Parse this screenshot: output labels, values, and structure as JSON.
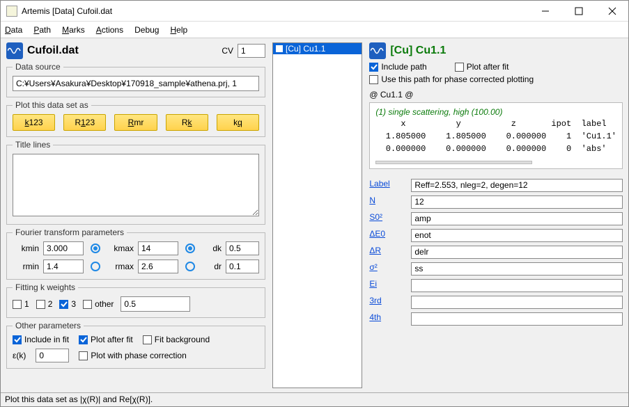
{
  "window": {
    "title": "Artemis [Data] Cufoil.dat"
  },
  "menu": {
    "data": "Data",
    "path": "Path",
    "marks": "Marks",
    "actions": "Actions",
    "debug": "Debug",
    "help": "Help"
  },
  "left": {
    "filename": "Cufoil.dat",
    "cv_label": "CV",
    "cv_value": "1",
    "source_legend": "Data source",
    "source_value": "C:¥Users¥Asakura¥Desktop¥170918_sample¥athena.prj, 1",
    "plot_legend": "Plot this data set as",
    "plot_buttons": {
      "k123": "k123",
      "r123": "R123",
      "rmr": "Rmr",
      "rk": "Rk",
      "kq": "kq"
    },
    "title_legend": "Title lines",
    "ft_legend": "Fourier transform parameters",
    "ft": {
      "kmin_l": "kmin",
      "kmin": "3.000",
      "kmax_l": "kmax",
      "kmax": "14",
      "dk_l": "dk",
      "dk": "0.5",
      "rmin_l": "rmin",
      "rmin": "1.4",
      "rmax_l": "rmax",
      "rmax": "2.6",
      "dr_l": "dr",
      "dr": "0.1"
    },
    "kw_legend": "Fitting k weights",
    "kw": {
      "l1": "1",
      "l2": "2",
      "l3": "3",
      "lother": "other",
      "other_val": "0.5"
    },
    "other_legend": "Other parameters",
    "other": {
      "inc": "Include in fit",
      "paf": "Plot after fit",
      "fitbg": "Fit background",
      "ek_l": "ε(k)",
      "ek": "0",
      "ppc": "Plot with phase correction"
    }
  },
  "mid": {
    "list_item": "[Cu] Cu1.1"
  },
  "right": {
    "title": "[Cu] Cu1.1",
    "include": "Include path",
    "paf": "Plot after fit",
    "pcp": "Use this path for phase corrected plotting",
    "pathhdr": "@ Cu1.1 @",
    "scatter": "(1) single scattering, high (100.00)",
    "table_hdr": "     x          y          z       ipot  label",
    "table_r1": "  1.805000    1.805000    0.000000    1  'Cu1.1'",
    "table_r2": "  0.000000    0.000000    0.000000    0  'abs'",
    "params": {
      "Label_l": "Label",
      "Label": "Reff=2.553, nleg=2, degen=12",
      "N_l": "N",
      "N": "12",
      "S02_l": "S0²",
      "S02": "amp",
      "dE0_l": "ΔE0",
      "dE0": "enot",
      "dR_l": "ΔR",
      "dR": "delr",
      "s2_l": "σ²",
      "s2": "ss",
      "Ei_l": "Ei",
      "Ei": "",
      "third_l": "3rd",
      "third": "",
      "fourth_l": "4th",
      "fourth": ""
    }
  },
  "status": "Plot this data set as |χ(R)| and Re[χ(R)]."
}
